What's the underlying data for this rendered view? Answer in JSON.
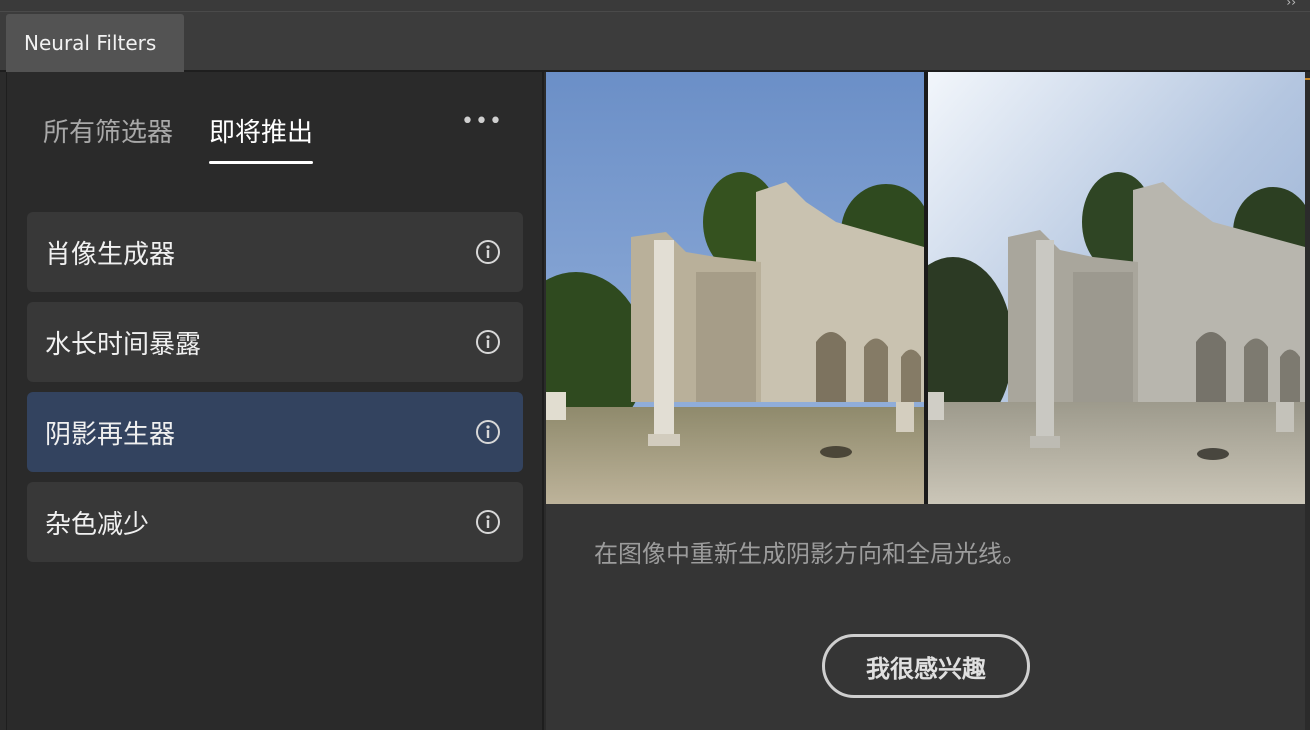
{
  "window": {
    "tab_title": "Neural Filters",
    "collapse_glyph": "››"
  },
  "filter_tabs": {
    "all": "所有筛选器",
    "upcoming": "即将推出",
    "more_glyph": "•••"
  },
  "filters": [
    {
      "label": "肖像生成器",
      "icon": "info-icon",
      "selected": false
    },
    {
      "label": "水长时间暴露",
      "icon": "info-icon",
      "selected": false
    },
    {
      "label": "阴影再生器",
      "icon": "info-icon",
      "selected": true
    },
    {
      "label": "杂色减少",
      "icon": "info-icon",
      "selected": false
    }
  ],
  "detail": {
    "description": "在图像中重新生成阴影方向和全局光线。",
    "interest_button": "我很感兴趣"
  },
  "colors": {
    "selected_item": "#33435f",
    "accent_edge": "#c98a2a"
  }
}
